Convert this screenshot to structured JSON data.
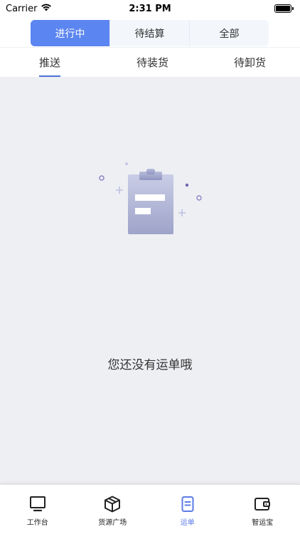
{
  "status": {
    "carrier": "Carrier",
    "time": "2:31 PM"
  },
  "segments": [
    {
      "label": "进行中",
      "active": true
    },
    {
      "label": "待结算",
      "active": false
    },
    {
      "label": "全部",
      "active": false
    }
  ],
  "subtabs": [
    {
      "label": "推送",
      "active": true
    },
    {
      "label": "待装货",
      "active": false
    },
    {
      "label": "待卸货",
      "active": false
    }
  ],
  "empty": {
    "message": "您还没有运单哦"
  },
  "tabbar": [
    {
      "label": "工作台",
      "icon": "monitor-icon",
      "active": false
    },
    {
      "label": "货源广场",
      "icon": "box-icon",
      "active": false
    },
    {
      "label": "运单",
      "icon": "document-icon",
      "active": true
    },
    {
      "label": "智运宝",
      "icon": "wallet-icon",
      "active": false
    }
  ],
  "colors": {
    "accent": "#5b85f0",
    "background": "#eeeff3",
    "active_tab": "#5b7be6"
  }
}
